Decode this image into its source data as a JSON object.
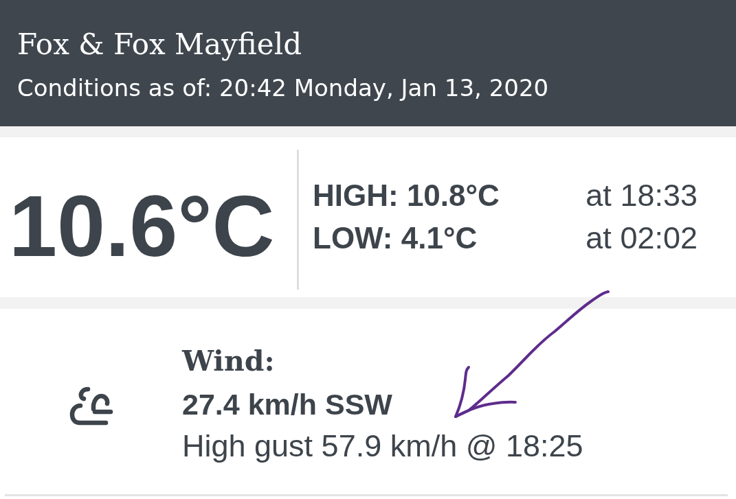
{
  "header": {
    "station": "Fox & Fox Mayfield",
    "updated": "Conditions as of: 20:42 Monday, Jan 13, 2020"
  },
  "current": {
    "temperature": "10.6°C",
    "extremes": [
      {
        "label": "HIGH: 10.8°C",
        "time": "at 18:33"
      },
      {
        "label": "LOW: 4.1°C",
        "time": "at 02:02"
      }
    ]
  },
  "wind": {
    "title": "Wind:",
    "speed": "27.4 km/h SSW",
    "gust": "High gust 57.9 km/h @ 18:25"
  },
  "annotations": [
    {
      "kind": "arrow"
    }
  ]
}
